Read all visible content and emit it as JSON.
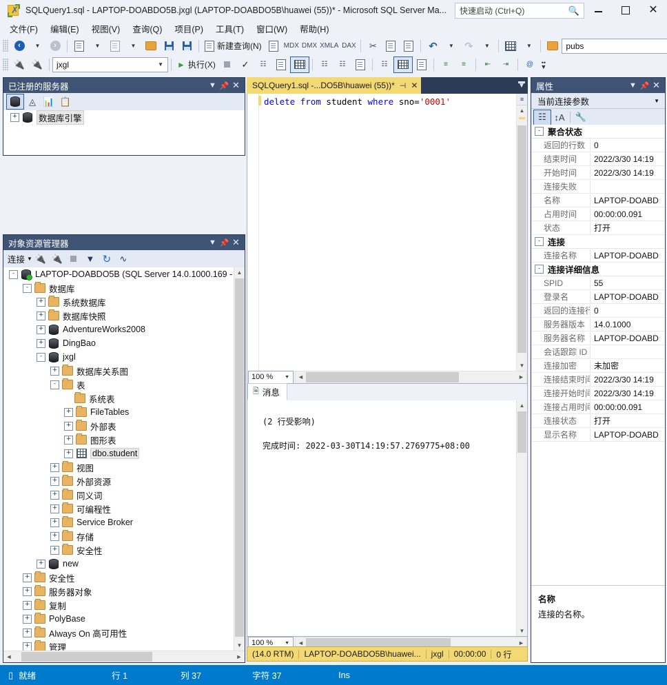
{
  "window": {
    "title": "SQLQuery1.sql - LAPTOP-DOABDO5B.jxgl (LAPTOP-DOABDO5B\\huawei (55))* - Microsoft SQL Server Ma...",
    "quick_launch_placeholder": "快速启动 (Ctrl+Q)",
    "minimize": "—",
    "maximize": "□",
    "close": "✕"
  },
  "menu": {
    "items": [
      {
        "label": "文件(F)"
      },
      {
        "label": "编辑(E)"
      },
      {
        "label": "视图(V)"
      },
      {
        "label": "查询(Q)"
      },
      {
        "label": "项目(P)"
      },
      {
        "label": "工具(T)"
      },
      {
        "label": "窗口(W)"
      },
      {
        "label": "帮助(H)"
      }
    ]
  },
  "toolbar1": {
    "new_query_label": "新建查询(N)",
    "mdx_label": "MDX",
    "dmx_label": "DMX",
    "xmla_label": "XMLA",
    "dax_label": "DAX",
    "database_combo_value": "pubs"
  },
  "toolbar2": {
    "database_combo_value": "jxgl",
    "execute_label": "执行(X)"
  },
  "registered_servers": {
    "title": "已注册的服务器",
    "tree": [
      {
        "label": "数据库引擎",
        "expander": "+",
        "icon": "database-icon",
        "selected": true
      }
    ]
  },
  "object_explorer": {
    "title": "对象资源管理器",
    "connect_label": "连接",
    "tree": [
      {
        "label": "LAPTOP-DOABDO5B (SQL Server 14.0.1000.169 - ",
        "expander": "-",
        "icon": "server-icon",
        "indent": 0
      },
      {
        "label": "数据库",
        "expander": "-",
        "icon": "folder-icon",
        "indent": 1
      },
      {
        "label": "系统数据库",
        "expander": "+",
        "icon": "folder-icon",
        "indent": 2
      },
      {
        "label": "数据库快照",
        "expander": "+",
        "icon": "folder-icon",
        "indent": 2
      },
      {
        "label": "AdventureWorks2008",
        "expander": "+",
        "icon": "database-icon",
        "indent": 2
      },
      {
        "label": "DingBao",
        "expander": "+",
        "icon": "database-icon",
        "indent": 2
      },
      {
        "label": "jxgl",
        "expander": "-",
        "icon": "database-icon",
        "indent": 2
      },
      {
        "label": "数据库关系图",
        "expander": "+",
        "icon": "folder-icon",
        "indent": 3
      },
      {
        "label": "表",
        "expander": "-",
        "icon": "folder-icon",
        "indent": 3
      },
      {
        "label": "系统表",
        "expander": "",
        "icon": "folder-icon",
        "indent": 4
      },
      {
        "label": "FileTables",
        "expander": "+",
        "icon": "folder-icon",
        "indent": 4
      },
      {
        "label": "外部表",
        "expander": "+",
        "icon": "folder-icon",
        "indent": 4
      },
      {
        "label": "图形表",
        "expander": "+",
        "icon": "folder-icon",
        "indent": 4
      },
      {
        "label": "dbo.student",
        "expander": "+",
        "icon": "table-icon",
        "indent": 4,
        "selected": true
      },
      {
        "label": "视图",
        "expander": "+",
        "icon": "folder-icon",
        "indent": 3
      },
      {
        "label": "外部资源",
        "expander": "+",
        "icon": "folder-icon",
        "indent": 3
      },
      {
        "label": "同义词",
        "expander": "+",
        "icon": "folder-icon",
        "indent": 3
      },
      {
        "label": "可编程性",
        "expander": "+",
        "icon": "folder-icon",
        "indent": 3
      },
      {
        "label": "Service Broker",
        "expander": "+",
        "icon": "folder-icon",
        "indent": 3
      },
      {
        "label": "存储",
        "expander": "+",
        "icon": "folder-icon",
        "indent": 3
      },
      {
        "label": "安全性",
        "expander": "+",
        "icon": "folder-icon",
        "indent": 3
      },
      {
        "label": "new",
        "expander": "+",
        "icon": "database-icon",
        "indent": 2
      },
      {
        "label": "安全性",
        "expander": "+",
        "icon": "folder-icon",
        "indent": 1
      },
      {
        "label": "服务器对象",
        "expander": "+",
        "icon": "folder-icon",
        "indent": 1
      },
      {
        "label": "复制",
        "expander": "+",
        "icon": "folder-icon",
        "indent": 1
      },
      {
        "label": "PolyBase",
        "expander": "+",
        "icon": "folder-icon",
        "indent": 1
      },
      {
        "label": "Always On 高可用性",
        "expander": "+",
        "icon": "folder-icon",
        "indent": 1
      },
      {
        "label": "管理",
        "expander": "+",
        "icon": "folder-icon",
        "indent": 1
      }
    ]
  },
  "editor": {
    "tab_label": "SQLQuery1.sql -...DO5B\\huawei (55))*",
    "tab_pin": "⊣",
    "tab_close": "✕",
    "code": {
      "kw_delete": "delete",
      "kw_from": "from",
      "tbl_student": " student ",
      "kw_where": "where",
      "col_sno": " sno=",
      "literal": "'0001'"
    },
    "zoom": "100 %",
    "results": {
      "tab_label": "消息",
      "lines": [
        "(2 行受影响)",
        "",
        "完成时间: 2022-03-30T14:19:57.2769775+08:00"
      ]
    },
    "status": {
      "version": "(14.0 RTM)",
      "user": "LAPTOP-DOABDO5B\\huawei...",
      "database": "jxgl",
      "elapsed": "00:00:00",
      "rows": "0 行"
    },
    "results_zoom": "100 %"
  },
  "properties": {
    "title": "属性",
    "combo_value": "当前连接参数",
    "groups": [
      {
        "name": "聚合状态",
        "expander": "-",
        "rows": [
          {
            "key": "返回的行数",
            "value": "0"
          },
          {
            "key": "结束时间",
            "value": "2022/3/30 14:19"
          },
          {
            "key": "开始时间",
            "value": "2022/3/30 14:19"
          },
          {
            "key": "连接失败",
            "value": ""
          },
          {
            "key": "名称",
            "value": "LAPTOP-DOABD"
          },
          {
            "key": "占用时间",
            "value": "00:00:00.091"
          },
          {
            "key": "状态",
            "value": "打开"
          }
        ]
      },
      {
        "name": "连接",
        "expander": "-",
        "rows": [
          {
            "key": "连接名称",
            "value": "LAPTOP-DOABD"
          }
        ]
      },
      {
        "name": "连接详细信息",
        "expander": "-",
        "rows": [
          {
            "key": "SPID",
            "value": "55"
          },
          {
            "key": "登录名",
            "value": "LAPTOP-DOABD"
          },
          {
            "key": "返回的连接行",
            "value": "0"
          },
          {
            "key": "服务器版本",
            "value": "14.0.1000"
          },
          {
            "key": "服务器名称",
            "value": "LAPTOP-DOABD"
          },
          {
            "key": "会话跟踪 ID",
            "value": ""
          },
          {
            "key": "连接加密",
            "value": "未加密"
          },
          {
            "key": "连接结束时间",
            "value": "2022/3/30 14:19"
          },
          {
            "key": "连接开始时间",
            "value": "2022/3/30 14:19"
          },
          {
            "key": "连接占用时间",
            "value": "00:00:00.091"
          },
          {
            "key": "连接状态",
            "value": "打开"
          },
          {
            "key": "显示名称",
            "value": "LAPTOP-DOABD"
          }
        ]
      }
    ],
    "description": {
      "title": "名称",
      "text": "连接的名称。"
    }
  },
  "statusbar": {
    "ready": "就绪",
    "row": "行 1",
    "col": "列 37",
    "chars": "字符 37",
    "insert_mode": "Ins"
  },
  "colors": {
    "accent": "#007acc",
    "panel_header": "#3f5475",
    "tab_active": "#f2d974",
    "keyword": "#0000ff",
    "string": "#cc0000",
    "window_chrome": "#2d3c56"
  }
}
